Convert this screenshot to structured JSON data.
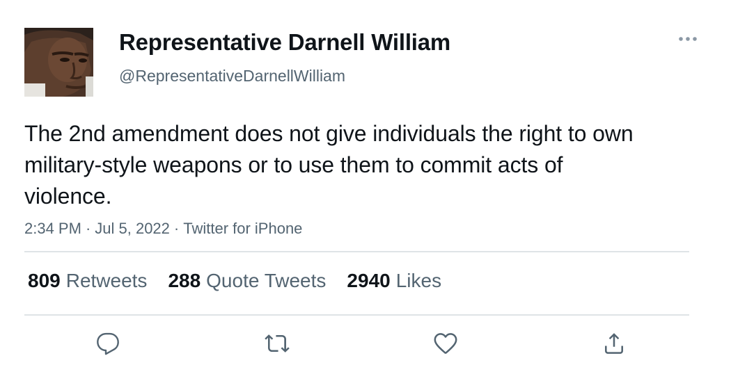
{
  "user": {
    "display_name": "Representative Darnell William",
    "handle": "@RepresentativeDarnellWilliam"
  },
  "tweet": {
    "text": "The 2nd amendment does not give individuals the right to own military-style weapons or to use them to commit acts of violence.",
    "time": "2:34 PM",
    "date": "Jul 5, 2022",
    "source": "Twitter for iPhone",
    "separator": "·"
  },
  "stats": {
    "retweets_count": "809",
    "retweets_label": "Retweets",
    "quotes_count": "288",
    "quotes_label": "Quote Tweets",
    "likes_count": "2940",
    "likes_label": "Likes"
  },
  "icons": {
    "more": "more-horizontal-icon",
    "reply": "reply-icon",
    "retweet": "retweet-icon",
    "like": "heart-icon",
    "share": "share-icon"
  },
  "colors": {
    "text_primary": "#0f1419",
    "text_secondary": "#536471",
    "divider": "#dfe3e6"
  }
}
